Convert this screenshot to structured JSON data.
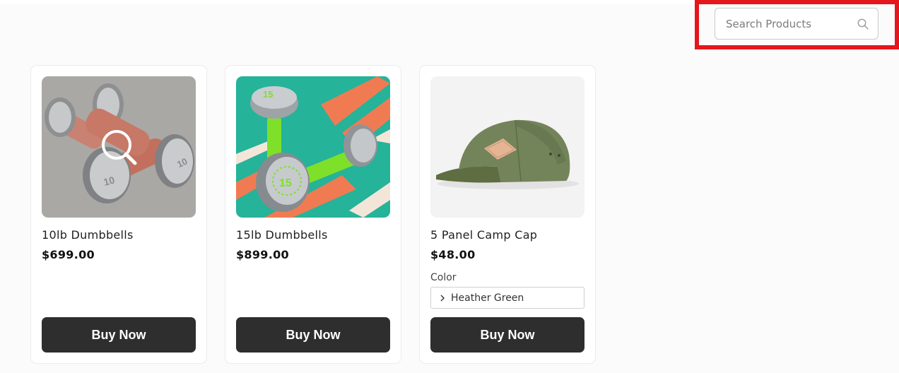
{
  "search": {
    "placeholder": "Search Products",
    "icon": "search-icon"
  },
  "products": [
    {
      "title": "10lb Dumbbells",
      "price": "$699.00",
      "button_label": "Buy Now",
      "image_overlay_icon": "zoom-icon"
    },
    {
      "title": "15lb Dumbbells",
      "price": "$899.00",
      "button_label": "Buy Now"
    },
    {
      "title": "5 Panel Camp Cap",
      "price": "$48.00",
      "option_label": "Color",
      "option_value": "Heather Green",
      "button_label": "Buy Now"
    }
  ],
  "colors": {
    "highlight": "#e5161c",
    "button_bg": "#2e2e2e",
    "page_bg": "#fbfbfb"
  }
}
